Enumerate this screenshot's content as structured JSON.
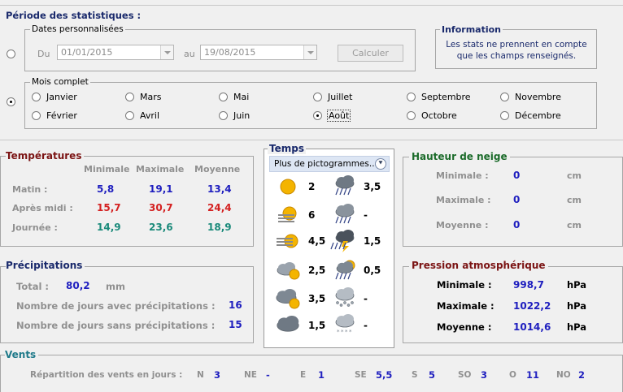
{
  "period": {
    "title": "Période des statistiques :",
    "custom_legend": "Dates personnalisées",
    "from_label": "Du",
    "from_value": "01/01/2015",
    "to_label": "au",
    "to_value": "19/08/2015",
    "compute_button": "Calculer",
    "info_title": "Information",
    "info_text": "Les stats ne prennent en compte que les champs renseignés.",
    "month_legend": "Mois complet",
    "months": [
      "Janvier",
      "Février",
      "Mars",
      "Avril",
      "Mai",
      "Juin",
      "Juillet",
      "Août",
      "Septembre",
      "Octobre",
      "Novembre",
      "Décembre"
    ],
    "selected_month": "Août"
  },
  "temperatures": {
    "title": "Températures",
    "columns": [
      "Minimale",
      "Maximale",
      "Moyenne"
    ],
    "rows": [
      {
        "label": "Matin :",
        "values": [
          "5,8",
          "19,1",
          "13,4"
        ]
      },
      {
        "label": "Après midi :",
        "values": [
          "15,7",
          "30,7",
          "24,4"
        ]
      },
      {
        "label": "Journée :",
        "values": [
          "14,9",
          "23,6",
          "18,9"
        ]
      }
    ]
  },
  "weather": {
    "title": "Temps",
    "dropdown": "Plus de pictogrammes...",
    "left": [
      {
        "icon": "sun-icon",
        "value": "2"
      },
      {
        "icon": "sun-fog-icon",
        "value": "6"
      },
      {
        "icon": "sun-haze-icon",
        "value": "4,5"
      },
      {
        "icon": "partly-cloudy-icon",
        "value": "2,5"
      },
      {
        "icon": "mostly-cloudy-icon",
        "value": "3,5"
      },
      {
        "icon": "overcast-icon",
        "value": "1,5"
      }
    ],
    "right": [
      {
        "icon": "rain-showers-icon",
        "value": "3,5"
      },
      {
        "icon": "heavy-rain-icon",
        "value": "-"
      },
      {
        "icon": "thunderstorm-icon",
        "value": "1,5"
      },
      {
        "icon": "sun-rain-icon",
        "value": "0,5"
      },
      {
        "icon": "hail-icon",
        "value": "-"
      },
      {
        "icon": "snow-icon",
        "value": "-"
      }
    ]
  },
  "snow": {
    "title": "Hauteur de neige",
    "rows": [
      {
        "label": "Minimale :",
        "value": "0",
        "unit": "cm"
      },
      {
        "label": "Maximale :",
        "value": "0",
        "unit": "cm"
      },
      {
        "label": "Moyenne :",
        "value": "0",
        "unit": "cm"
      }
    ]
  },
  "precip": {
    "title": "Précipitations",
    "total_label": "Total :",
    "total_value": "80,2",
    "total_unit": "mm",
    "with_label": "Nombre de jours avec précipitations :",
    "with_value": "16",
    "without_label": "Nombre de jours sans précipitations :",
    "without_value": "15"
  },
  "pressure": {
    "title": "Pression atmosphérique",
    "rows": [
      {
        "label": "Minimale :",
        "value": "998,7",
        "unit": "hPa"
      },
      {
        "label": "Maximale :",
        "value": "1022,2",
        "unit": "hPa"
      },
      {
        "label": "Moyenne :",
        "value": "1014,6",
        "unit": "hPa"
      }
    ]
  },
  "winds": {
    "title": "Vents",
    "label": "Répartition des vents en jours :",
    "dirs": [
      {
        "dir": "N",
        "value": "3"
      },
      {
        "dir": "NE",
        "value": "-"
      },
      {
        "dir": "E",
        "value": "1"
      },
      {
        "dir": "SE",
        "value": "5,5"
      },
      {
        "dir": "S",
        "value": "5"
      },
      {
        "dir": "SO",
        "value": "3"
      },
      {
        "dir": "O",
        "value": "11"
      },
      {
        "dir": "NO",
        "value": "2"
      }
    ]
  },
  "colors": {
    "title_red": "#7b1414",
    "title_blue": "#1a2a6c",
    "title_green": "#1b6b2a",
    "title_teal": "#1f7a8a",
    "value_blue": "#1f1fbf"
  }
}
